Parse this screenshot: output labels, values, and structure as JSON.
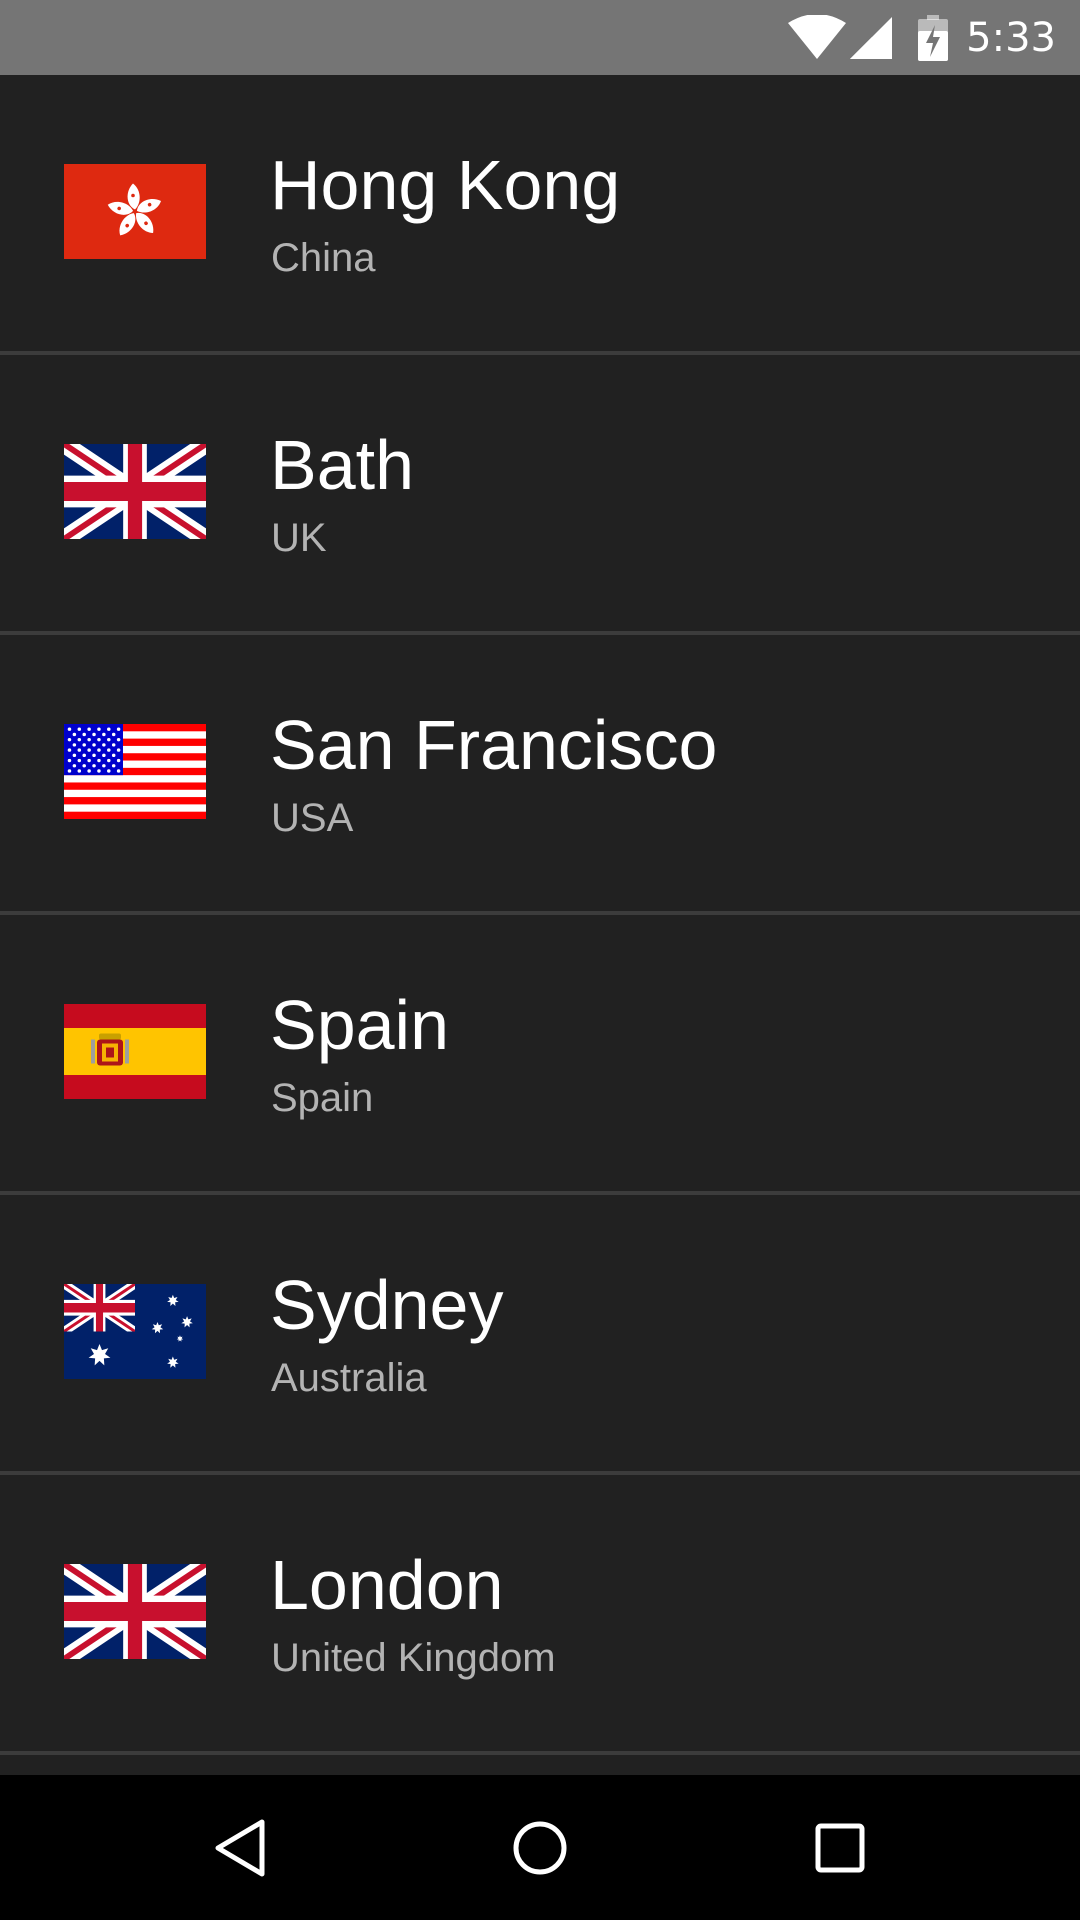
{
  "status_bar": {
    "time": "5:33",
    "icons": [
      "wifi-icon",
      "signal-icon",
      "battery-charging-icon"
    ]
  },
  "cities": [
    {
      "name": "Hong Kong",
      "country": "China",
      "flag": "hong-kong-flag"
    },
    {
      "name": "Bath",
      "country": "UK",
      "flag": "uk-flag"
    },
    {
      "name": "San Francisco",
      "country": "USA",
      "flag": "usa-flag"
    },
    {
      "name": "Spain",
      "country": "Spain",
      "flag": "spain-flag"
    },
    {
      "name": "Sydney",
      "country": "Australia",
      "flag": "australia-flag"
    },
    {
      "name": "London",
      "country": "United Kingdom",
      "flag": "uk-flag"
    }
  ],
  "nav_bar": {
    "buttons": [
      "back-icon",
      "home-icon",
      "recents-icon"
    ]
  },
  "colors": {
    "status_bar": "#757575",
    "list_background": "#212121",
    "divider": "#3c3c3c",
    "primary_text": "#ffffff",
    "secondary_text": "#b3b3b3",
    "nav_bar": "#000000"
  }
}
